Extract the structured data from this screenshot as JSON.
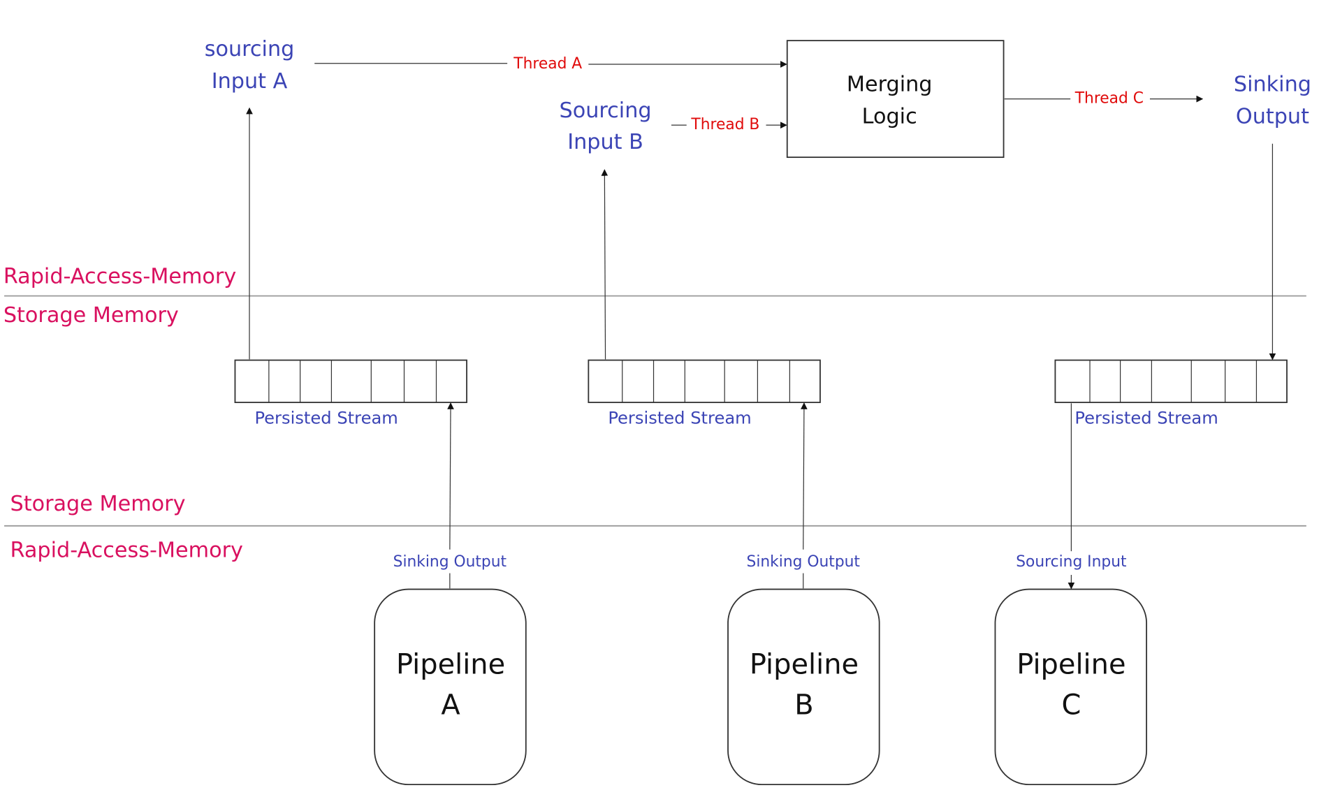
{
  "layers": {
    "top_rapid": "Rapid-Access-Memory",
    "top_storage": "Storage Memory",
    "bottom_storage": "Storage Memory",
    "bottom_rapid": "Rapid-Access-Memory"
  },
  "top": {
    "input_a": [
      "sourcing",
      "Input A"
    ],
    "input_b": [
      "Sourcing",
      "Input B"
    ],
    "merge": [
      "Merging",
      "Logic"
    ],
    "output": [
      "Sinking",
      "Output"
    ],
    "thread_a": "Thread A",
    "thread_b": "Thread B",
    "thread_c": "Thread C"
  },
  "streams": [
    "Persisted Stream",
    "Persisted Stream",
    "Persisted Stream"
  ],
  "pipelines": [
    {
      "lines": [
        "Pipeline",
        "A"
      ],
      "port": "Sinking Output"
    },
    {
      "lines": [
        "Pipeline",
        "B"
      ],
      "port": "Sinking Output"
    },
    {
      "lines": [
        "Pipeline",
        "C"
      ],
      "port": "Sourcing Input"
    }
  ],
  "colors": {
    "node_text": "#3b44b5",
    "thread_text": "#e00b0b",
    "layer_text": "#d9105f"
  }
}
